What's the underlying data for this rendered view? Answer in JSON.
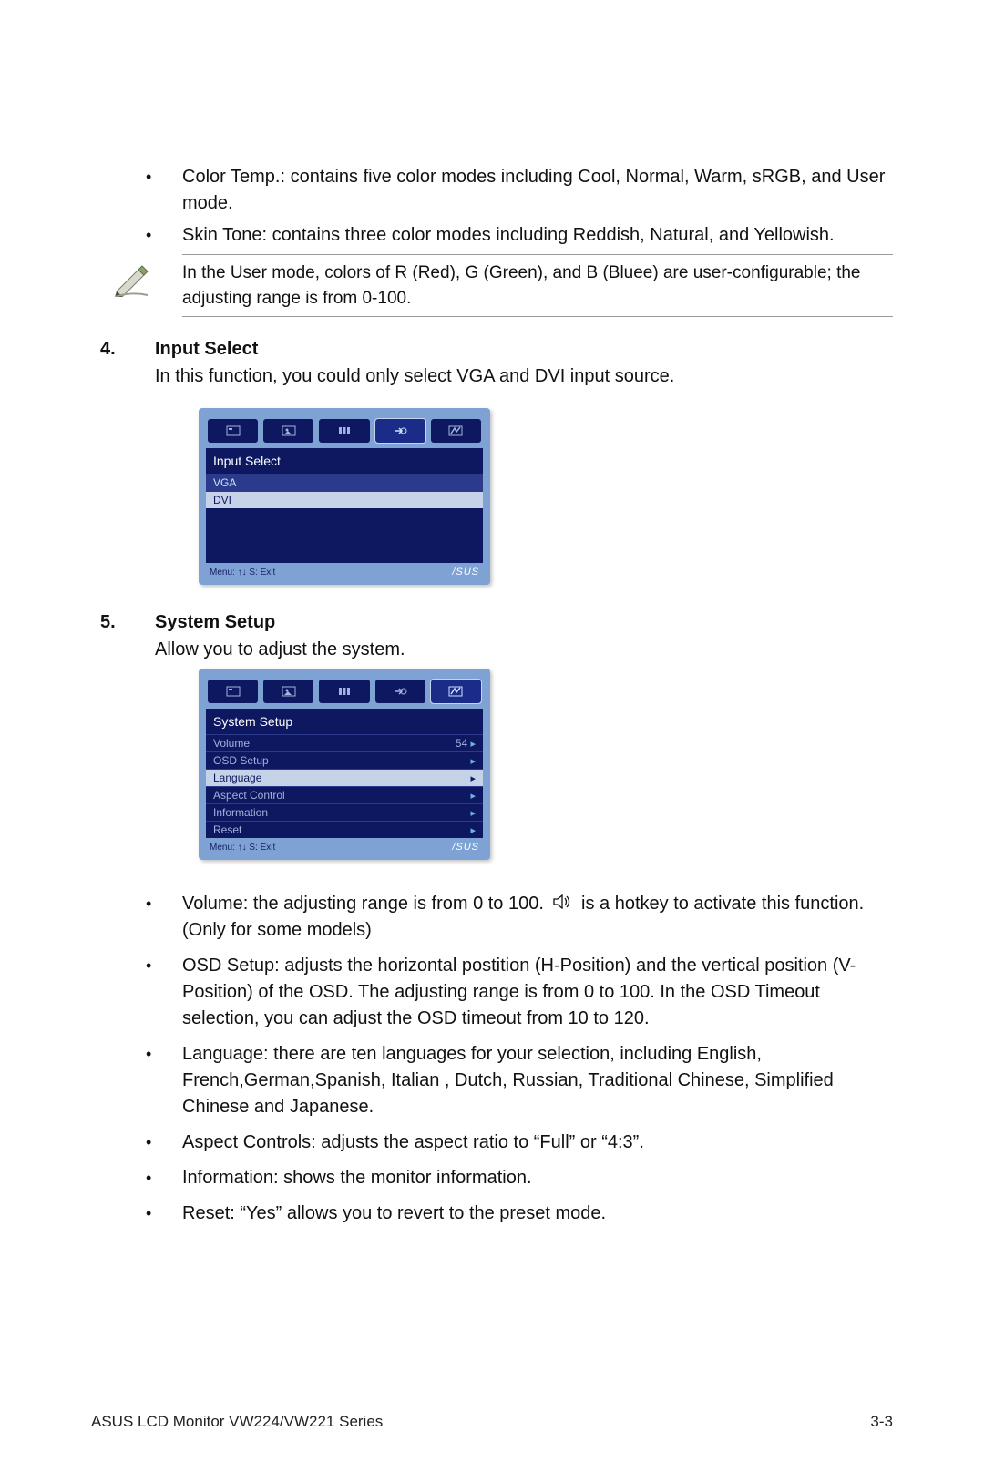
{
  "pre_bullets": [
    "Color Temp.: contains five color modes including Cool, Normal, Warm, sRGB, and User mode.",
    "Skin Tone: contains three color modes including Reddish, Natural, and Yellowish."
  ],
  "note": "In the User mode, colors of R (Red), G (Green), and B (Bluee) are user-configurable; the adjusting range is from 0-100.",
  "section4": {
    "num": "4.",
    "title": "Input Select",
    "body": "In this function, you could only select  VGA  and DVI input source."
  },
  "osd1": {
    "title": "Input Select",
    "items": [
      "VGA",
      "DVI"
    ],
    "selected_index": 0,
    "foot_left": "Menu: ↑↓   S: Exit",
    "foot_brand": "/SUS"
  },
  "section5": {
    "num": "5.",
    "title": "System Setup",
    "body": "Allow you to adjust the system."
  },
  "osd2": {
    "title": "System Setup",
    "items": [
      {
        "label": "Volume",
        "value": "54",
        "sel": false
      },
      {
        "label": "OSD Setup",
        "value": "",
        "sel": false
      },
      {
        "label": "Language",
        "value": "",
        "sel": true
      },
      {
        "label": "Aspect Control",
        "value": "",
        "sel": false
      },
      {
        "label": "Information",
        "value": "",
        "sel": false
      },
      {
        "label": "Reset",
        "value": "",
        "sel": false
      }
    ],
    "foot_left": "Menu: ↑↓   S: Exit",
    "foot_brand": "/SUS"
  },
  "post_bullets": {
    "b1a": "Volume: the adjusting range is from 0 to 100. ",
    "b1b": " is a hotkey to activate this function. (Only for some models)",
    "b2": "OSD Setup: adjusts the horizontal postition (H-Position) and the vertical position (V-Position) of the OSD. The adjusting range is from 0 to 100. In the OSD Timeout selection, you can adjust the OSD timeout from 10 to 120.",
    "b3": "Language: there are ten languages for your selection, including English, French,German,Spanish, Italian , Dutch,  Russian, Traditional Chinese, Simplified Chinese and Japanese.",
    "b4": "Aspect Controls: adjusts the aspect ratio to “Full” or “4:3”.",
    "b5": "Information: shows the monitor information.",
    "b6": "Reset: “Yes” allows you to revert to the preset mode."
  },
  "footer": {
    "left": "ASUS LCD Monitor VW224/VW221 Series",
    "right": "3-3"
  }
}
